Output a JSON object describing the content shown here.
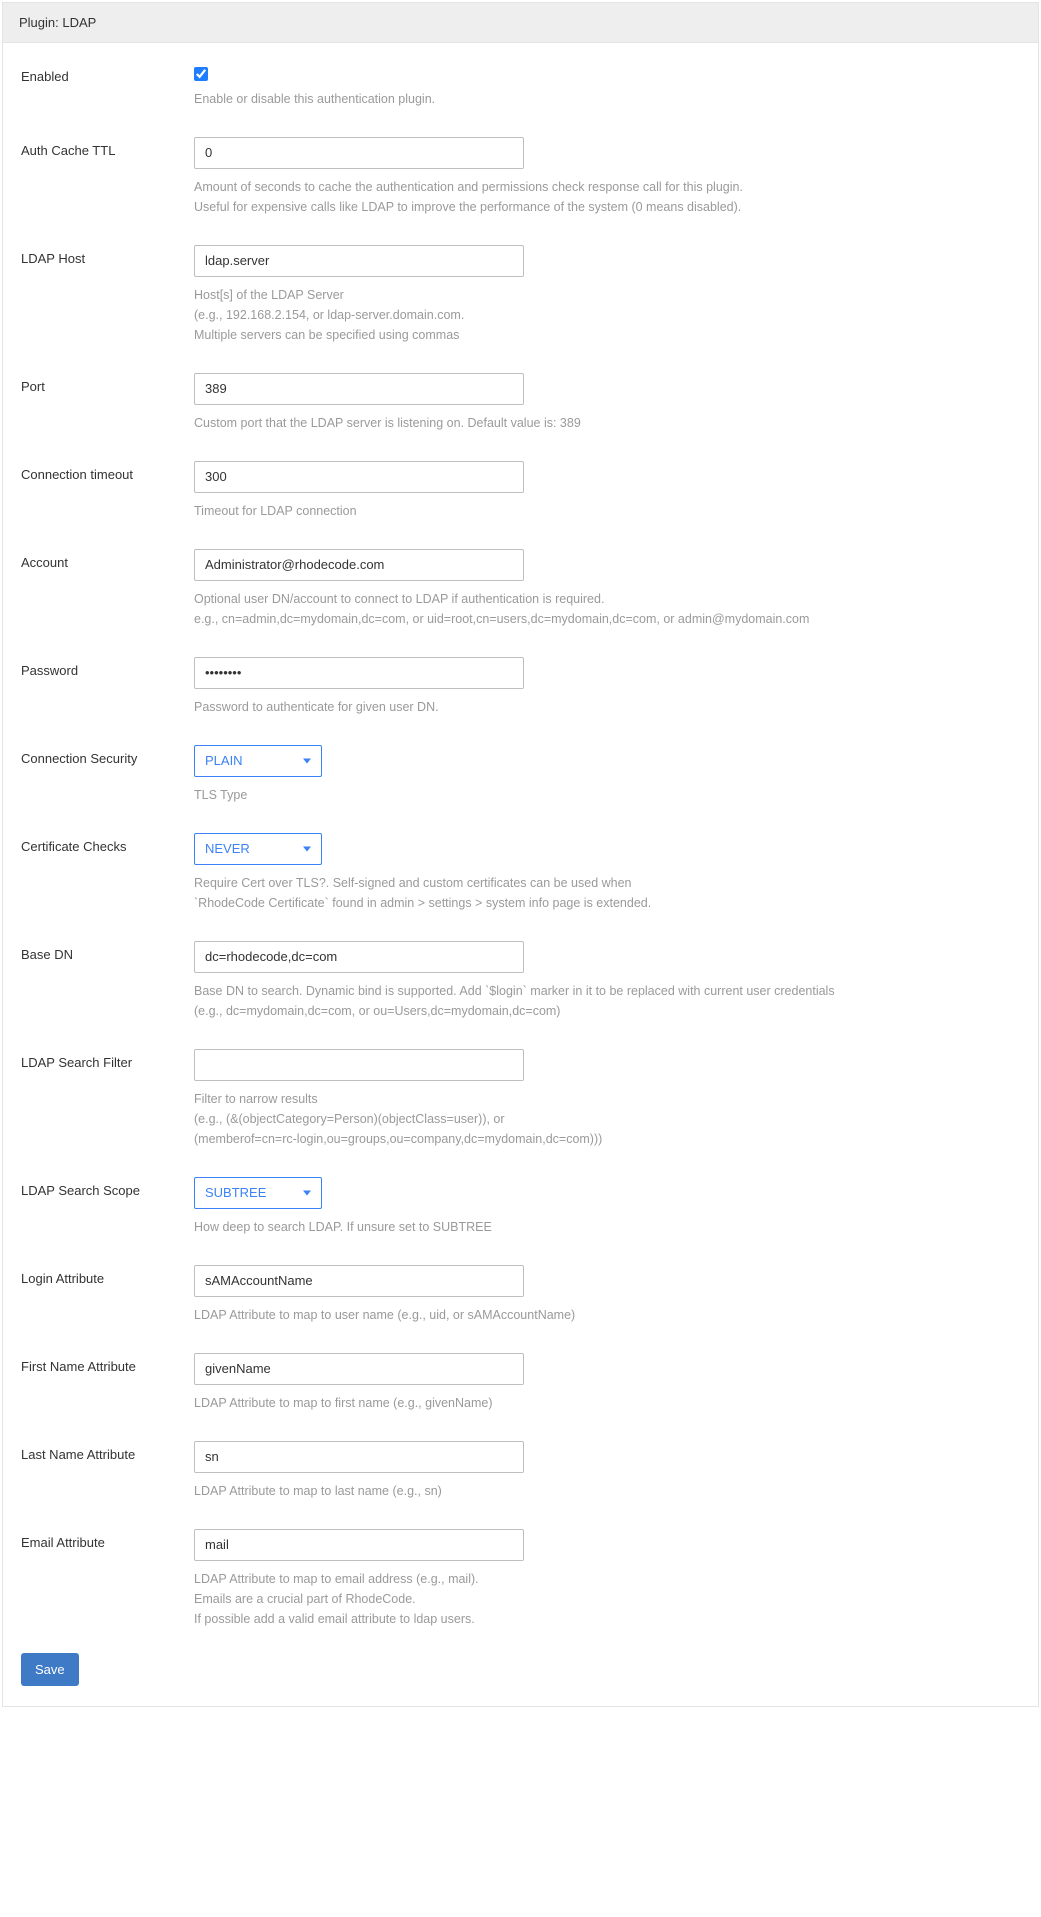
{
  "header": {
    "title": "Plugin: LDAP"
  },
  "fields": {
    "enabled": {
      "label": "Enabled",
      "checked": true,
      "help1": "Enable or disable this authentication plugin."
    },
    "auth_cache_ttl": {
      "label": "Auth Cache TTL",
      "value": "0",
      "help1": "Amount of seconds to cache the authentication and permissions check response call for this plugin.",
      "help2": "Useful for expensive calls like LDAP to improve the performance of the system (0 means disabled)."
    },
    "ldap_host": {
      "label": "LDAP Host",
      "value": "ldap.server",
      "help1": "Host[s] of the LDAP Server",
      "help2": "(e.g., 192.168.2.154, or ldap-server.domain.com.",
      "help3": " Multiple servers can be specified using commas"
    },
    "port": {
      "label": "Port",
      "value": "389",
      "help1": "Custom port that the LDAP server is listening on. Default value is: 389"
    },
    "conn_timeout": {
      "label": "Connection timeout",
      "value": "300",
      "help1": "Timeout for LDAP connection"
    },
    "account": {
      "label": "Account",
      "value": "Administrator@rhodecode.com",
      "help1": "Optional user DN/account to connect to LDAP if authentication is required.",
      "help2": "e.g., cn=admin,dc=mydomain,dc=com, or uid=root,cn=users,dc=mydomain,dc=com, or admin@mydomain.com"
    },
    "password": {
      "label": "Password",
      "value": "••••••••",
      "help1": "Password to authenticate for given user DN."
    },
    "conn_security": {
      "label": "Connection Security",
      "value": "PLAIN",
      "help1": "TLS Type"
    },
    "cert_checks": {
      "label": "Certificate Checks",
      "value": "NEVER",
      "help1": "Require Cert over TLS?. Self-signed and custom certificates can be used when",
      "help2": "`RhodeCode Certificate` found in admin > settings > system info page is extended."
    },
    "base_dn": {
      "label": "Base DN",
      "value": "dc=rhodecode,dc=com",
      "help1": "Base DN to search. Dynamic bind is supported. Add `$login` marker in it to be replaced with current user credentials",
      "help2": "(e.g., dc=mydomain,dc=com, or ou=Users,dc=mydomain,dc=com)"
    },
    "search_filter": {
      "label": "LDAP Search Filter",
      "value": "",
      "help1": "Filter to narrow results",
      "help2": "(e.g., (&(objectCategory=Person)(objectClass=user)), or",
      "help3": "(memberof=cn=rc-login,ou=groups,ou=company,dc=mydomain,dc=com)))"
    },
    "search_scope": {
      "label": "LDAP Search Scope",
      "value": "SUBTREE",
      "help1": "How deep to search LDAP. If unsure set to SUBTREE"
    },
    "login_attr": {
      "label": "Login Attribute",
      "value": "sAMAccountName",
      "help1": "LDAP Attribute to map to user name (e.g., uid, or sAMAccountName)"
    },
    "first_name_attr": {
      "label": "First Name Attribute",
      "value": "givenName",
      "help1": "LDAP Attribute to map to first name (e.g., givenName)"
    },
    "last_name_attr": {
      "label": "Last Name Attribute",
      "value": "sn",
      "help1": "LDAP Attribute to map to last name (e.g., sn)"
    },
    "email_attr": {
      "label": "Email Attribute",
      "value": "mail",
      "help1": "LDAP Attribute to map to email address (e.g., mail).",
      "help2": "Emails are a crucial part of RhodeCode.",
      "help3": "If possible add a valid email attribute to ldap users."
    }
  },
  "actions": {
    "save": "Save"
  }
}
